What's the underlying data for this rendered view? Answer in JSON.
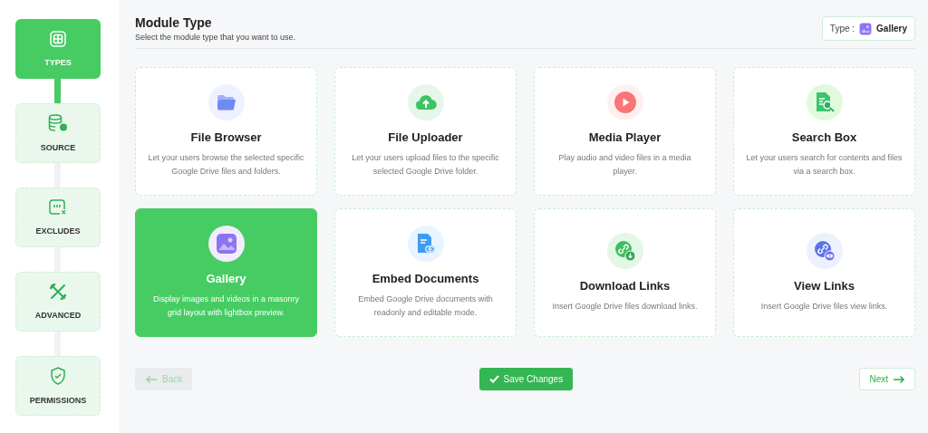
{
  "steps": [
    {
      "label": "TYPES",
      "kind": "types",
      "selected": true
    },
    {
      "label": "SOURCE",
      "kind": "source",
      "selected": false
    },
    {
      "label": "EXCLUDES",
      "kind": "excludes",
      "selected": false
    },
    {
      "label": "ADVANCED",
      "kind": "advanced",
      "selected": false
    },
    {
      "label": "PERMISSIONS",
      "kind": "permissions",
      "selected": false
    }
  ],
  "header": {
    "title": "Module Type",
    "subtitle": "Select the module type that you want to use.",
    "type_label": "Type :",
    "type_value": "Gallery"
  },
  "modules": [
    {
      "title": "File Browser",
      "description": "Let your users browse the selected specific Google Drive files and folders.",
      "kind": "folder",
      "selected": false
    },
    {
      "title": "File Uploader",
      "description": "Let your users upload files to the specific selected Google Drive folder.",
      "kind": "upload",
      "selected": false
    },
    {
      "title": "Media Player",
      "description": "Play audio and video files in a media player.",
      "kind": "play",
      "selected": false
    },
    {
      "title": "Search Box",
      "description": "Let your users search for contents and files via a search box.",
      "kind": "search-doc",
      "selected": false
    },
    {
      "title": "Gallery",
      "description": "Display images and videos in a masonry grid layout with lightbox preview.",
      "kind": "image",
      "selected": true
    },
    {
      "title": "Embed Documents",
      "description": "Embed Google Drive documents with readonly and editable mode.",
      "kind": "embed-doc",
      "selected": false
    },
    {
      "title": "Download Links",
      "description": "Insert Google Drive files download links.",
      "kind": "download-link",
      "selected": false
    },
    {
      "title": "View Links",
      "description": "Insert Google Drive files view links.",
      "kind": "view-link",
      "selected": false
    }
  ],
  "footer": {
    "back": {
      "label": "Back",
      "disabled": true
    },
    "save": {
      "label": "Save Changes"
    },
    "next": {
      "label": "Next",
      "disabled": false
    }
  }
}
